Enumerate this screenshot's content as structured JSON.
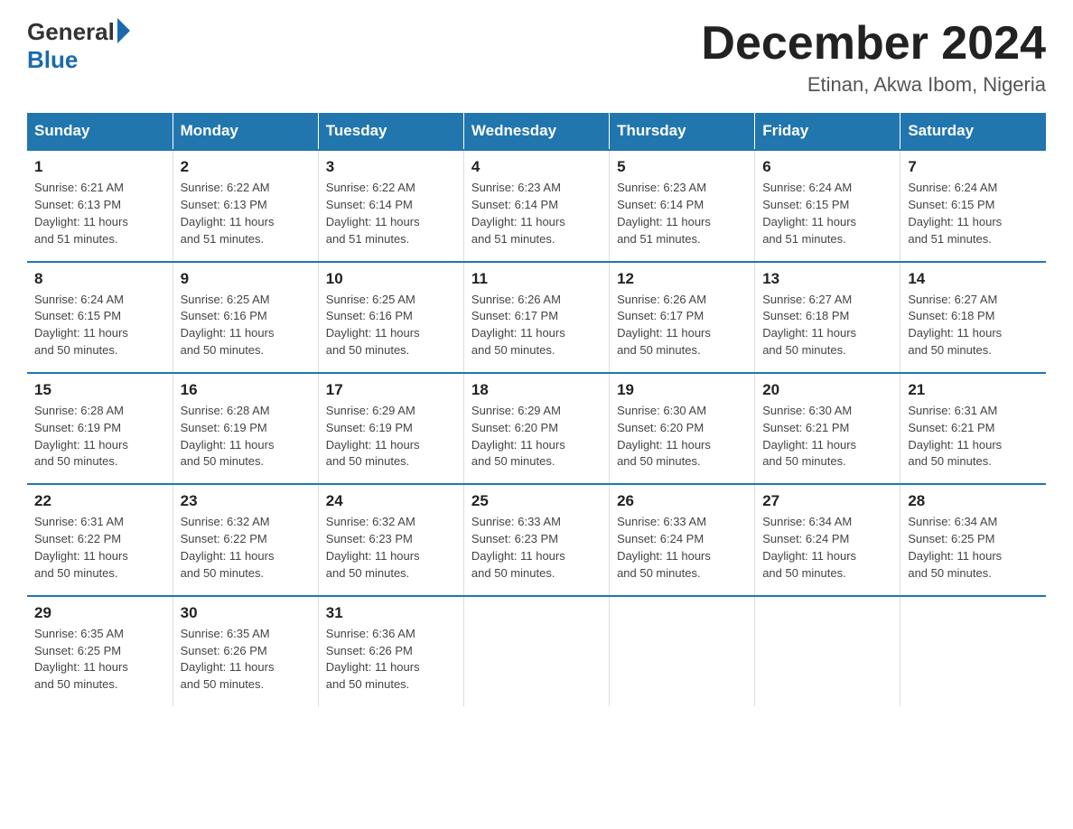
{
  "header": {
    "logo_text": "General",
    "logo_blue": "Blue",
    "title": "December 2024",
    "subtitle": "Etinan, Akwa Ibom, Nigeria"
  },
  "days_of_week": [
    "Sunday",
    "Monday",
    "Tuesday",
    "Wednesday",
    "Thursday",
    "Friday",
    "Saturday"
  ],
  "weeks": [
    [
      {
        "day": "1",
        "sunrise": "6:21 AM",
        "sunset": "6:13 PM",
        "daylight": "11 hours and 51 minutes."
      },
      {
        "day": "2",
        "sunrise": "6:22 AM",
        "sunset": "6:13 PM",
        "daylight": "11 hours and 51 minutes."
      },
      {
        "day": "3",
        "sunrise": "6:22 AM",
        "sunset": "6:14 PM",
        "daylight": "11 hours and 51 minutes."
      },
      {
        "day": "4",
        "sunrise": "6:23 AM",
        "sunset": "6:14 PM",
        "daylight": "11 hours and 51 minutes."
      },
      {
        "day": "5",
        "sunrise": "6:23 AM",
        "sunset": "6:14 PM",
        "daylight": "11 hours and 51 minutes."
      },
      {
        "day": "6",
        "sunrise": "6:24 AM",
        "sunset": "6:15 PM",
        "daylight": "11 hours and 51 minutes."
      },
      {
        "day": "7",
        "sunrise": "6:24 AM",
        "sunset": "6:15 PM",
        "daylight": "11 hours and 51 minutes."
      }
    ],
    [
      {
        "day": "8",
        "sunrise": "6:24 AM",
        "sunset": "6:15 PM",
        "daylight": "11 hours and 50 minutes."
      },
      {
        "day": "9",
        "sunrise": "6:25 AM",
        "sunset": "6:16 PM",
        "daylight": "11 hours and 50 minutes."
      },
      {
        "day": "10",
        "sunrise": "6:25 AM",
        "sunset": "6:16 PM",
        "daylight": "11 hours and 50 minutes."
      },
      {
        "day": "11",
        "sunrise": "6:26 AM",
        "sunset": "6:17 PM",
        "daylight": "11 hours and 50 minutes."
      },
      {
        "day": "12",
        "sunrise": "6:26 AM",
        "sunset": "6:17 PM",
        "daylight": "11 hours and 50 minutes."
      },
      {
        "day": "13",
        "sunrise": "6:27 AM",
        "sunset": "6:18 PM",
        "daylight": "11 hours and 50 minutes."
      },
      {
        "day": "14",
        "sunrise": "6:27 AM",
        "sunset": "6:18 PM",
        "daylight": "11 hours and 50 minutes."
      }
    ],
    [
      {
        "day": "15",
        "sunrise": "6:28 AM",
        "sunset": "6:19 PM",
        "daylight": "11 hours and 50 minutes."
      },
      {
        "day": "16",
        "sunrise": "6:28 AM",
        "sunset": "6:19 PM",
        "daylight": "11 hours and 50 minutes."
      },
      {
        "day": "17",
        "sunrise": "6:29 AM",
        "sunset": "6:19 PM",
        "daylight": "11 hours and 50 minutes."
      },
      {
        "day": "18",
        "sunrise": "6:29 AM",
        "sunset": "6:20 PM",
        "daylight": "11 hours and 50 minutes."
      },
      {
        "day": "19",
        "sunrise": "6:30 AM",
        "sunset": "6:20 PM",
        "daylight": "11 hours and 50 minutes."
      },
      {
        "day": "20",
        "sunrise": "6:30 AM",
        "sunset": "6:21 PM",
        "daylight": "11 hours and 50 minutes."
      },
      {
        "day": "21",
        "sunrise": "6:31 AM",
        "sunset": "6:21 PM",
        "daylight": "11 hours and 50 minutes."
      }
    ],
    [
      {
        "day": "22",
        "sunrise": "6:31 AM",
        "sunset": "6:22 PM",
        "daylight": "11 hours and 50 minutes."
      },
      {
        "day": "23",
        "sunrise": "6:32 AM",
        "sunset": "6:22 PM",
        "daylight": "11 hours and 50 minutes."
      },
      {
        "day": "24",
        "sunrise": "6:32 AM",
        "sunset": "6:23 PM",
        "daylight": "11 hours and 50 minutes."
      },
      {
        "day": "25",
        "sunrise": "6:33 AM",
        "sunset": "6:23 PM",
        "daylight": "11 hours and 50 minutes."
      },
      {
        "day": "26",
        "sunrise": "6:33 AM",
        "sunset": "6:24 PM",
        "daylight": "11 hours and 50 minutes."
      },
      {
        "day": "27",
        "sunrise": "6:34 AM",
        "sunset": "6:24 PM",
        "daylight": "11 hours and 50 minutes."
      },
      {
        "day": "28",
        "sunrise": "6:34 AM",
        "sunset": "6:25 PM",
        "daylight": "11 hours and 50 minutes."
      }
    ],
    [
      {
        "day": "29",
        "sunrise": "6:35 AM",
        "sunset": "6:25 PM",
        "daylight": "11 hours and 50 minutes."
      },
      {
        "day": "30",
        "sunrise": "6:35 AM",
        "sunset": "6:26 PM",
        "daylight": "11 hours and 50 minutes."
      },
      {
        "day": "31",
        "sunrise": "6:36 AM",
        "sunset": "6:26 PM",
        "daylight": "11 hours and 50 minutes."
      },
      {
        "day": "",
        "sunrise": "",
        "sunset": "",
        "daylight": ""
      },
      {
        "day": "",
        "sunrise": "",
        "sunset": "",
        "daylight": ""
      },
      {
        "day": "",
        "sunrise": "",
        "sunset": "",
        "daylight": ""
      },
      {
        "day": "",
        "sunrise": "",
        "sunset": "",
        "daylight": ""
      }
    ]
  ],
  "labels": {
    "sunrise_prefix": "Sunrise: ",
    "sunset_prefix": "Sunset: ",
    "daylight_prefix": "Daylight: "
  }
}
